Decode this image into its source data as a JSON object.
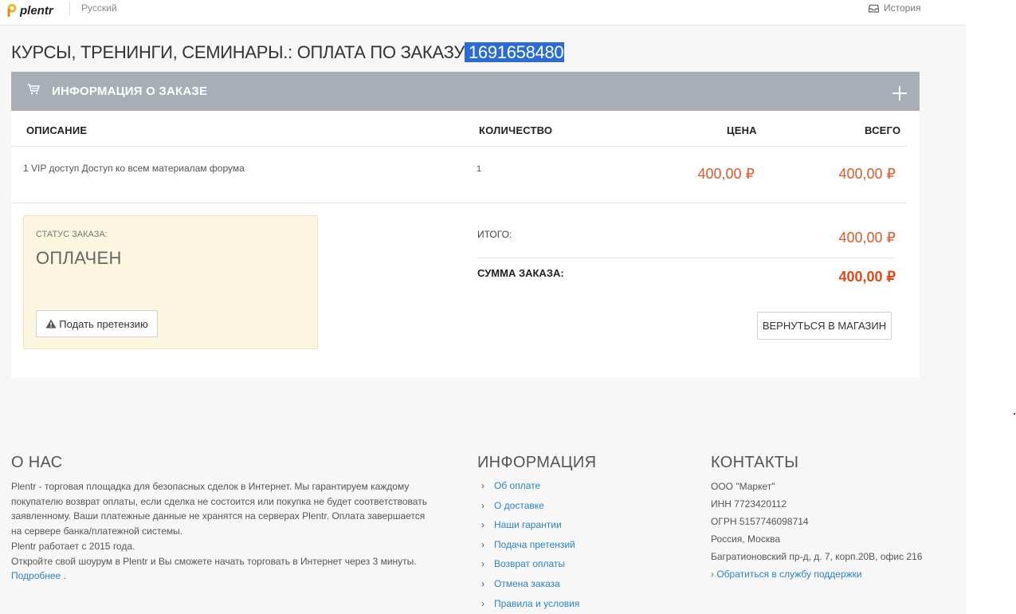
{
  "header": {
    "logo_text": "plentr",
    "language": "Русский",
    "history_label": "История"
  },
  "title": {
    "prefix": "КУРСЫ, ТРЕНИНГИ, СЕМИНАРЫ.: ОПЛАТА ПО ЗАКАЗУ",
    "order_id": "1691658480"
  },
  "order_card": {
    "header_title": "ИНФОРМАЦИЯ О ЗАКАЗЕ",
    "columns": {
      "description": "ОПИСАНИЕ",
      "quantity": "КОЛИЧЕСТВО",
      "price": "ЦЕНА",
      "total": "ВСЕГО"
    },
    "items": [
      {
        "description": "1 VIP доступ Доступ ко всем материалам форума",
        "quantity": "1",
        "price": "400,00 ₽",
        "total": "400,00 ₽"
      }
    ],
    "status": {
      "label": "СТАТУС ЗАКАЗА:",
      "value": "ОПЛАЧЕН",
      "claim_button": "Подать претензию"
    },
    "summary": {
      "subtotal_label": "ИТОГО:",
      "subtotal_value": "400,00 ₽",
      "total_label": "СУММА ЗАКАЗА:",
      "total_value": "400,00 ₽"
    },
    "return_button": "ВЕРНУТЬСЯ В МАГАЗИН"
  },
  "footer": {
    "about": {
      "title": "О НАС",
      "text": "Plentr - торговая площадка для безопасных сделок в Интернет. Мы гарантируем каждому покупателю возврат оплаты, если сделка не состоится или покупка не будет соответствовать заявленному. Ваши платежные данные не хранятся на серверах Plentr. Оплата завершается на сервере банка/платежной системы.",
      "since": "Plentr работает с 2015 года.",
      "cta": "Откройте свой шоурум в Plentr и Вы сможете начать торговать в Интернет через 3 минуты.",
      "more_link": "Подробнее",
      "more_suffix": " ."
    },
    "info": {
      "title": "ИНФОРМАЦИЯ",
      "links": [
        "Об оплате",
        "О доставке",
        "Наши гарантии",
        "Подача претензий",
        "Возврат оплаты",
        "Отмена заказа",
        "Правила и условия"
      ]
    },
    "contacts": {
      "title": "КОНТАКТЫ",
      "company": "ООО \"Маркет\"",
      "inn": "ИНН 7723420112",
      "ogrn": "ОГРН 5157746098714",
      "city": "Россия, Москва",
      "address": "Багратионовский пр-д, д. 7, корп.20В, офис 216",
      "support_link": "Обратиться в службу поддержки"
    }
  },
  "colors": {
    "accent_price": "#e05a2b",
    "link": "#2a84c6",
    "header_bar": "#a8aeb5",
    "selection": "#2a6bd6",
    "status_bg": "#fcf6e0"
  }
}
